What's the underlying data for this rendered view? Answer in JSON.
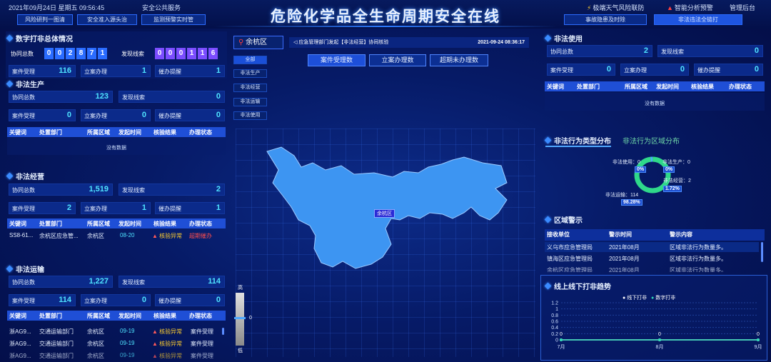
{
  "header": {
    "datetime": "2021年09月24日 星期五 09:56:45",
    "public_service": "安全公共服务",
    "title": "危险化学品全生命周期安全在线",
    "left_nav": [
      "风险研判一图清",
      "安全准入源头治",
      "监测预警实时管"
    ],
    "right_top": [
      {
        "icon": "flash-icon",
        "label": "极端天气风险联防"
      },
      {
        "icon": "alarm-icon",
        "label": "智能分析预警"
      },
      {
        "icon": "",
        "label": "管理后台"
      }
    ],
    "right_nav": [
      "事故隐患及时除",
      "非法违法全链打"
    ]
  },
  "overview": {
    "title": "数字打非总体情况",
    "xietong_label": "协同总数",
    "xietong_digits": [
      "0",
      "0",
      "2",
      "8",
      "7",
      "1"
    ],
    "faxian_label": "发现线索",
    "faxian_digits": [
      "0",
      "0",
      "0",
      "1",
      "1",
      "6"
    ],
    "anjian_label": "案件受理",
    "anjian_value": "116",
    "lian_label": "立案办理",
    "lian_value": "1",
    "cuiban_label": "催办提醒",
    "cuiban_value": "1"
  },
  "production": {
    "title": "非法生产",
    "xietong_label": "协同总数",
    "xietong_value": "123",
    "faxian_label": "发现线索",
    "faxian_value": "0",
    "anjian_label": "案件受理",
    "anjian_value": "0",
    "lian_label": "立案办理",
    "lian_value": "0",
    "cuiban_label": "催办提醒",
    "cuiban_value": "0",
    "headers": [
      "关键词",
      "处置部门",
      "所属区域",
      "发起时间",
      "核验结果",
      "办理状态"
    ],
    "nodata": "没有数据"
  },
  "business": {
    "title": "非法经营",
    "xietong_label": "协同总数",
    "xietong_value": "1,519",
    "faxian_label": "发现线索",
    "faxian_value": "2",
    "anjian_label": "案件受理",
    "anjian_value": "2",
    "lian_label": "立案办理",
    "lian_value": "1",
    "cuiban_label": "催办提醒",
    "cuiban_value": "1",
    "headers": [
      "关键词",
      "处置部门",
      "所属区域",
      "发起时间",
      "核验结果",
      "办理状态"
    ],
    "rows": [
      [
        "SS8-61...",
        "余杭区应急管...",
        "余杭区",
        "08-20",
        "核验异常",
        "超期催办"
      ]
    ]
  },
  "transport": {
    "title": "非法运输",
    "xietong_label": "协同总数",
    "xietong_value": "1,227",
    "faxian_label": "发现线索",
    "faxian_value": "114",
    "anjian_label": "案件受理",
    "anjian_value": "114",
    "lian_label": "立案办理",
    "lian_value": "0",
    "cuiban_label": "催办提醒",
    "cuiban_value": "0",
    "headers": [
      "关键词",
      "处置部门",
      "所属区域",
      "发起时间",
      "核验结果",
      "办理状态"
    ],
    "rows": [
      [
        "浙AG9...",
        "交通运输部门",
        "余杭区",
        "09-19",
        "核验异常",
        "案件受理"
      ],
      [
        "浙AG9...",
        "交通运输部门",
        "余杭区",
        "09-19",
        "核验异常",
        "案件受理"
      ],
      [
        "浙AG9...",
        "交通运输部门",
        "余杭区",
        "09-19",
        "核验异常",
        "案件受理"
      ]
    ]
  },
  "center": {
    "region": "余杭区",
    "notice": "应急管理部门发起【非法经营】协同核验",
    "notice_time": "2021-09-24 08:36:17",
    "filters": [
      "全部",
      "非法生产",
      "非法经营",
      "非法运输",
      "非法使用"
    ],
    "tabs": [
      "案件受理数",
      "立案办理数",
      "超期未办理数"
    ],
    "map_label": "余杭区",
    "slider_top": "高",
    "slider_bottom": "低",
    "slider_value": "0"
  },
  "usage": {
    "title": "非法使用",
    "xietong_label": "协同总数",
    "xietong_value": "2",
    "faxian_label": "发现线索",
    "faxian_value": "0",
    "anjian_label": "案件受理",
    "anjian_value": "0",
    "lian_label": "立案办理",
    "lian_value": "0",
    "cuiban_label": "催办提醒",
    "cuiban_value": "0",
    "headers": [
      "关键词",
      "处置部门",
      "所属区域",
      "发起时间",
      "核验结果",
      "办理状态"
    ],
    "nodata": "没有数据"
  },
  "distribution": {
    "tab_active": "非法行为类型分布",
    "tab_other": "非法行为区域分布",
    "labels": {
      "use": "非法使用：0",
      "prod": "非法生产：0",
      "biz": "非法经营：2",
      "trans": "非法运输：114"
    },
    "badges": {
      "use": "0%",
      "prod": "0%",
      "biz": "1.72%",
      "trans": "98.28%"
    },
    "colors": {
      "trans": "#2fd88a",
      "biz": "#4fa8ff"
    }
  },
  "alerts": {
    "title": "区域警示",
    "headers": [
      "接收单位",
      "警示时间",
      "警示内容"
    ],
    "rows": [
      [
        "义乌市应急管理局",
        "2021年08月",
        "区域非法行为数量多。"
      ],
      [
        "镇海区应急管理局",
        "2021年08月",
        "区域非法行为数量多。"
      ],
      [
        "余杭区应急管理局",
        "2021年08月",
        "区域非法行为数量多。"
      ]
    ]
  },
  "trend": {
    "title": "线上线下打非趋势",
    "legend": [
      "线下打非",
      "数字打非"
    ],
    "colors": [
      "#ffffff",
      "#2fd8b5"
    ],
    "yticks": [
      "1.2",
      "1",
      "0.8",
      "0.6",
      "0.4",
      "0.2",
      "0"
    ],
    "xticks": [
      "7月",
      "8月",
      "9月"
    ],
    "point_labels": [
      "0",
      "0",
      "0"
    ],
    "chart_data": {
      "type": "line",
      "categories": [
        "7月",
        "8月",
        "9月"
      ],
      "series": [
        {
          "name": "线下打非",
          "values": [
            0,
            0,
            0
          ]
        },
        {
          "name": "数字打非",
          "values": [
            0,
            0,
            0
          ]
        }
      ],
      "ylim": [
        0,
        1.2
      ]
    }
  }
}
